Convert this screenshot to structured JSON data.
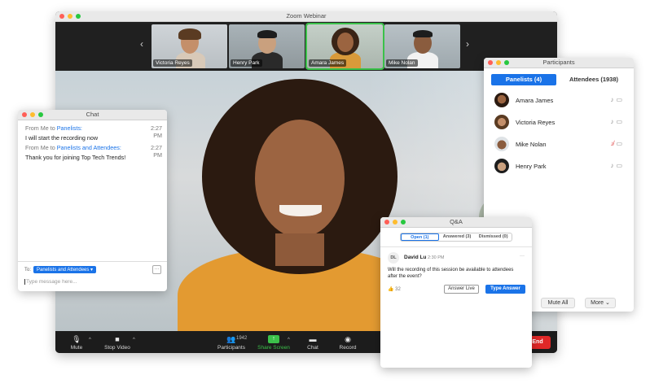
{
  "zoom_window": {
    "title": "Zoom Webinar",
    "filmstrip": {
      "prev_arrow": "‹",
      "next_arrow": "›",
      "participants": [
        {
          "name": "Victoria Reyes",
          "active": false
        },
        {
          "name": "Henry Park",
          "active": false
        },
        {
          "name": "Amara James",
          "active": true
        },
        {
          "name": "Mike Nolan",
          "active": false
        }
      ]
    },
    "controls": {
      "mute": "Mute",
      "stop_video": "Stop Video",
      "participants": "Participants",
      "participants_count": "1942",
      "share_screen": "Share Screen",
      "chat": "Chat",
      "record": "Record",
      "end": "End"
    }
  },
  "chat_window": {
    "title": "Chat",
    "messages": [
      {
        "from_prefix": "From Me to",
        "to": "Panelists:",
        "time": "2:27 PM",
        "text": "I will start the recording now"
      },
      {
        "from_prefix": "From Me to",
        "to": "Panelists and Attendees:",
        "time": "2:27 PM",
        "text": "Thank you for joining Top Tech Trends!"
      }
    ],
    "to_label": "To:",
    "to_value": "Panelists and Attendees ▾",
    "more": "···",
    "input_placeholder": "Type message here..."
  },
  "participants_window": {
    "title": "Participants",
    "tab_panelists": "Panelists (4)",
    "tab_attendees": "Attendees (1938)",
    "panelists": [
      {
        "name": "Amara James",
        "muted": false
      },
      {
        "name": "Victoria Reyes",
        "muted": false
      },
      {
        "name": "Mike Nolan",
        "muted": true
      },
      {
        "name": "Henry Park",
        "muted": false
      }
    ],
    "mute_all": "Mute All",
    "more": "More ⌄"
  },
  "qa_window": {
    "title": "Q&A",
    "tabs": [
      "Open (1)",
      "Answered (3)",
      "Dismissed (0)"
    ],
    "question": {
      "initials": "DL",
      "name": "David Lu",
      "time": "2:30 PM",
      "menu": "···",
      "text": "Will the recording of this session be available to attendees after the event?",
      "likes": "32",
      "answer_live": "Answer Live",
      "type_answer": "Type Answer"
    }
  },
  "colors": {
    "accent_blue": "#1a73e8",
    "active_green": "#3bc14a",
    "end_red": "#e02828",
    "muted_red": "#e04848"
  }
}
